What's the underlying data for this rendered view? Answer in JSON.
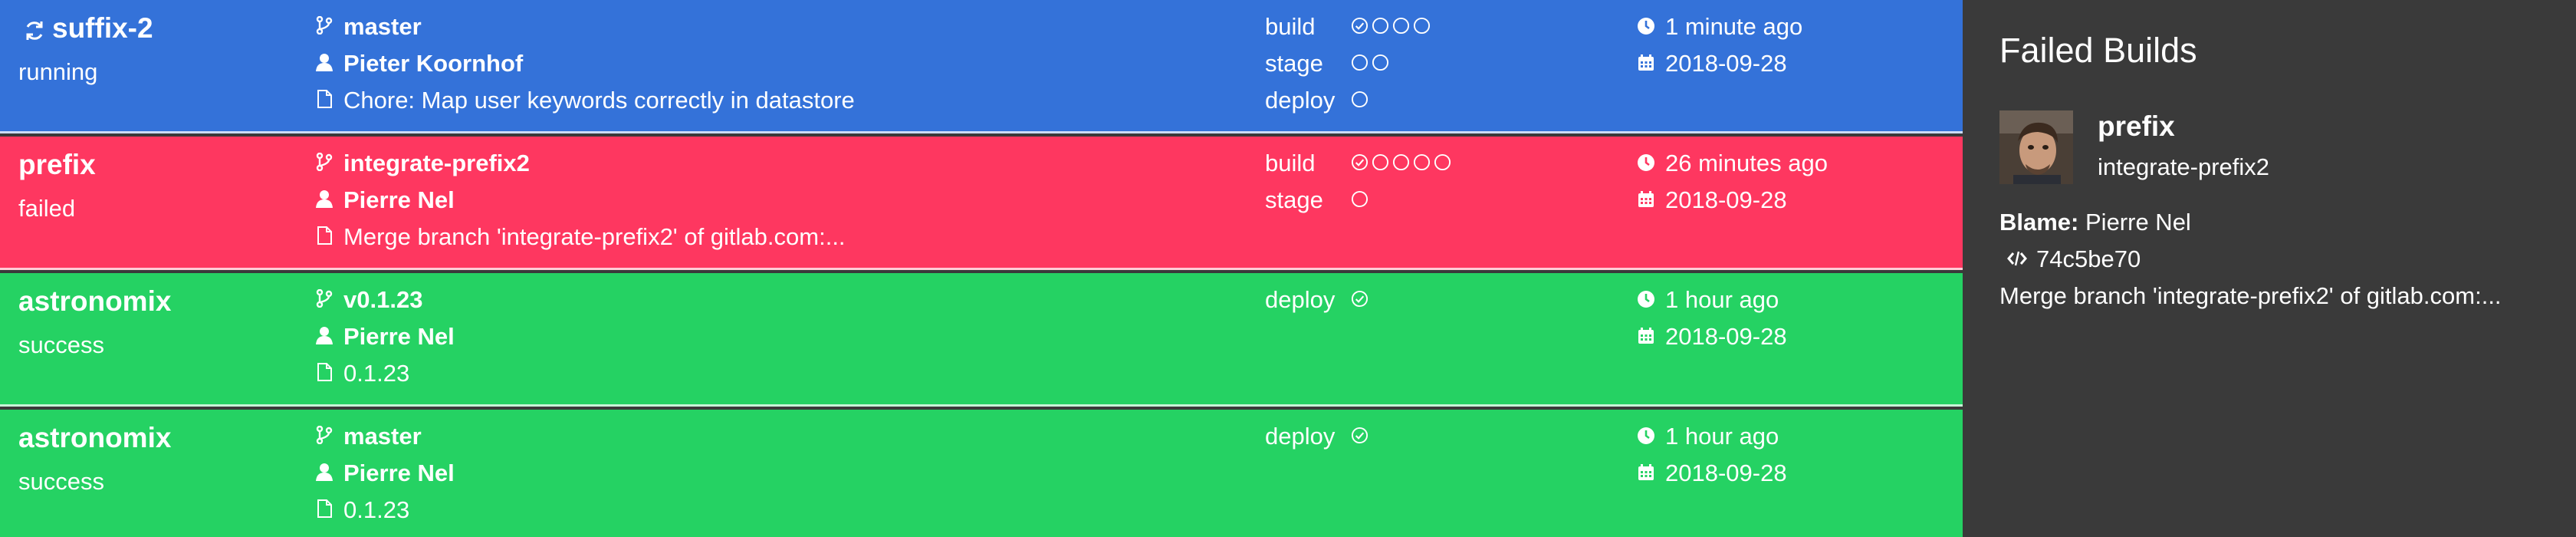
{
  "colors": {
    "running": "#3472d9",
    "failed": "#fe3760",
    "success": "#25d263",
    "sidebar_bg": "#3a3a3a",
    "text": "#ffffff"
  },
  "icons": {
    "branch": "code-branch-icon",
    "author": "user-icon",
    "commit": "file-icon",
    "relative_time": "clock-icon",
    "date": "calendar-icon",
    "running": "sync-spinner-icon",
    "stage_success": "check-circle-icon",
    "stage_pending": "empty-circle-icon",
    "hash": "code-icon"
  },
  "pipelines": [
    {
      "project": "suffix-2",
      "status": "running",
      "branch": "master",
      "author": "Pieter Koornhof",
      "commit_message": "Chore: Map user keywords correctly in datastore",
      "stages": [
        {
          "name": "build",
          "jobs": [
            "success",
            "pending",
            "pending",
            "pending"
          ]
        },
        {
          "name": "stage",
          "jobs": [
            "pending",
            "pending"
          ]
        },
        {
          "name": "deploy",
          "jobs": [
            "pending"
          ]
        }
      ],
      "relative_time": "1 minute ago",
      "date": "2018-09-28"
    },
    {
      "project": "prefix",
      "status": "failed",
      "branch": "integrate-prefix2",
      "author": "Pierre Nel",
      "commit_message": "Merge branch 'integrate-prefix2' of gitlab.com:...",
      "stages": [
        {
          "name": "build",
          "jobs": [
            "success",
            "pending",
            "pending",
            "pending",
            "pending"
          ]
        },
        {
          "name": "stage",
          "jobs": [
            "pending"
          ]
        }
      ],
      "relative_time": "26 minutes ago",
      "date": "2018-09-28"
    },
    {
      "project": "astronomix",
      "status": "success",
      "branch": "v0.1.23",
      "author": "Pierre Nel",
      "commit_message": "0.1.23",
      "stages": [
        {
          "name": "deploy",
          "jobs": [
            "success"
          ]
        }
      ],
      "relative_time": "1 hour ago",
      "date": "2018-09-28"
    },
    {
      "project": "astronomix",
      "status": "success",
      "branch": "master",
      "author": "Pierre Nel",
      "commit_message": "0.1.23",
      "stages": [
        {
          "name": "deploy",
          "jobs": [
            "success"
          ]
        }
      ],
      "relative_time": "1 hour ago",
      "date": "2018-09-28"
    }
  ],
  "sidebar": {
    "title": "Failed Builds",
    "failed_builds": [
      {
        "project": "prefix",
        "branch": "integrate-prefix2",
        "blame_label": "Blame:",
        "blame_name": "Pierre Nel",
        "commit_hash": "74c5be70",
        "commit_message": "Merge branch 'integrate-prefix2' of gitlab.com:..."
      }
    ]
  }
}
